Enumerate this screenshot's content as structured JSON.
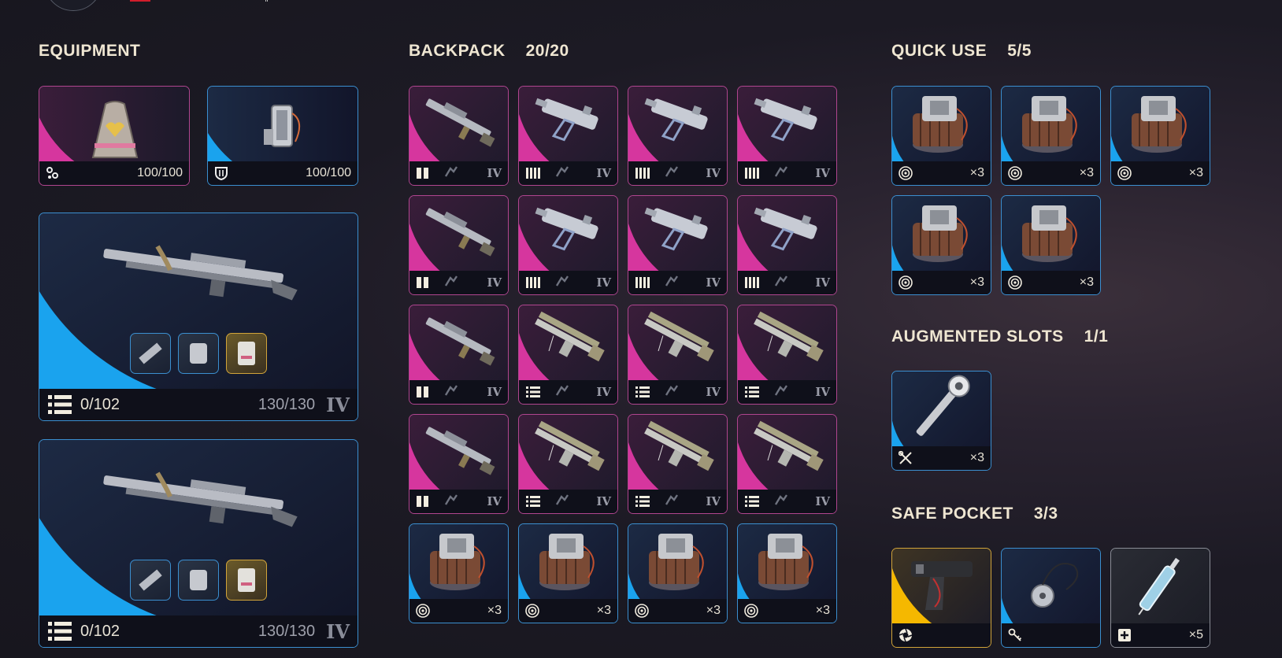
{
  "equipment": {
    "title": "EQUIPMENT",
    "augment": {
      "icon": "augment-icon",
      "durability": "100/100"
    },
    "shield": {
      "icon": "shield-icon",
      "durability": "100/100"
    },
    "weapons": [
      {
        "ammo": "0/102",
        "durability": "130/130",
        "tier": "IV"
      },
      {
        "ammo": "0/102",
        "durability": "130/130",
        "tier": "IV"
      }
    ]
  },
  "backpack": {
    "title": "BACKPACK",
    "count": "20/20",
    "slots": [
      {
        "kind": "rifle",
        "rarity": "pink",
        "ammo_icon": "heavy-ammo-icon",
        "tier": "IV"
      },
      {
        "kind": "smg",
        "rarity": "pink",
        "ammo_icon": "light-ammo-icon",
        "tier": "IV"
      },
      {
        "kind": "smg",
        "rarity": "pink",
        "ammo_icon": "light-ammo-icon",
        "tier": "IV"
      },
      {
        "kind": "smg",
        "rarity": "pink",
        "ammo_icon": "light-ammo-icon",
        "tier": "IV"
      },
      {
        "kind": "rifle",
        "rarity": "pink",
        "ammo_icon": "heavy-ammo-icon",
        "tier": "IV"
      },
      {
        "kind": "smg",
        "rarity": "pink",
        "ammo_icon": "light-ammo-icon",
        "tier": "IV"
      },
      {
        "kind": "smg",
        "rarity": "pink",
        "ammo_icon": "light-ammo-icon",
        "tier": "IV"
      },
      {
        "kind": "smg",
        "rarity": "pink",
        "ammo_icon": "light-ammo-icon",
        "tier": "IV"
      },
      {
        "kind": "rifle",
        "rarity": "pink",
        "ammo_icon": "heavy-ammo-icon",
        "tier": "IV"
      },
      {
        "kind": "launcher",
        "rarity": "pink",
        "ammo_icon": "medium-ammo-icon",
        "tier": "IV"
      },
      {
        "kind": "launcher",
        "rarity": "pink",
        "ammo_icon": "medium-ammo-icon",
        "tier": "IV"
      },
      {
        "kind": "launcher",
        "rarity": "pink",
        "ammo_icon": "medium-ammo-icon",
        "tier": "IV"
      },
      {
        "kind": "rifle",
        "rarity": "pink",
        "ammo_icon": "heavy-ammo-icon",
        "tier": "IV"
      },
      {
        "kind": "launcher",
        "rarity": "pink",
        "ammo_icon": "medium-ammo-icon",
        "tier": "IV"
      },
      {
        "kind": "launcher",
        "rarity": "pink",
        "ammo_icon": "medium-ammo-icon",
        "tier": "IV"
      },
      {
        "kind": "launcher",
        "rarity": "pink",
        "ammo_icon": "medium-ammo-icon",
        "tier": "IV"
      },
      {
        "kind": "grenade",
        "rarity": "blue",
        "type_icon": "target-icon",
        "qty": "×3"
      },
      {
        "kind": "grenade",
        "rarity": "blue",
        "type_icon": "target-icon",
        "qty": "×3"
      },
      {
        "kind": "grenade",
        "rarity": "blue",
        "type_icon": "target-icon",
        "qty": "×3"
      },
      {
        "kind": "grenade",
        "rarity": "blue",
        "type_icon": "target-icon",
        "qty": "×3"
      }
    ]
  },
  "quick_use": {
    "title": "QUICK USE",
    "count": "5/5",
    "slots": [
      {
        "kind": "grenade",
        "rarity": "blue",
        "type_icon": "target-icon",
        "qty": "×3"
      },
      {
        "kind": "grenade",
        "rarity": "blue",
        "type_icon": "target-icon",
        "qty": "×3"
      },
      {
        "kind": "grenade",
        "rarity": "blue",
        "type_icon": "target-icon",
        "qty": "×3"
      },
      {
        "kind": "grenade",
        "rarity": "blue",
        "type_icon": "target-icon",
        "qty": "×3"
      },
      {
        "kind": "grenade",
        "rarity": "blue",
        "type_icon": "target-icon",
        "qty": "×3"
      }
    ]
  },
  "augmented": {
    "title": "AUGMENTED SLOTS",
    "count": "1/1",
    "slots": [
      {
        "kind": "tool",
        "rarity": "blue",
        "type_icon": "tools-icon",
        "qty": "×3"
      }
    ]
  },
  "safe_pocket": {
    "title": "SAFE POCKET",
    "count": "3/3",
    "slots": [
      {
        "kind": "gun-device",
        "rarity": "gold",
        "type_icon": "aperture-icon",
        "qty": ""
      },
      {
        "kind": "key",
        "rarity": "blue",
        "type_icon": "key-icon",
        "qty": ""
      },
      {
        "kind": "syringe",
        "rarity": "gray",
        "type_icon": "medical-plus-icon",
        "qty": "×5"
      }
    ]
  },
  "colors": {
    "pink": "#d6369e",
    "blue": "#1aa3ee",
    "gold": "#f5b800",
    "gray": "#8a8d96"
  }
}
